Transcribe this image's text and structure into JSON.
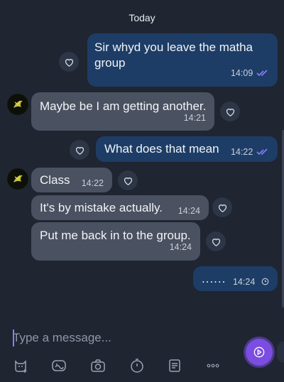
{
  "date_separator": "Today",
  "messages": [
    {
      "id": "m1",
      "direction": "out",
      "text_line1": "Sir whyd you leave the matha",
      "text_line2": "group",
      "time": "14:09",
      "status": "read"
    },
    {
      "id": "m2",
      "direction": "in",
      "text": "Maybe be I am getting another.",
      "time": "14:21"
    },
    {
      "id": "m3",
      "direction": "out",
      "text": "What does that mean",
      "time": "14:22",
      "status": "read"
    },
    {
      "id": "m4",
      "direction": "in",
      "text": "Class",
      "time": "14:22"
    },
    {
      "id": "m5",
      "direction": "in",
      "text": "It's by mistake actually.",
      "time": "14:24"
    },
    {
      "id": "m6",
      "direction": "in",
      "text": "Put me back in to the group.",
      "time": "14:24"
    },
    {
      "id": "m7",
      "direction": "out",
      "text": "......",
      "time": "14:24",
      "status": "pending"
    }
  ],
  "composer": {
    "placeholder": "Type a message..."
  },
  "icons": {
    "like": "heart-icon",
    "avatar": "contact-avatar",
    "toolbar": [
      "sticker-icon",
      "gif-sticker-icon",
      "camera-icon",
      "timer-icon",
      "notes-icon",
      "more-icon"
    ],
    "send": "voice-send-icon"
  },
  "colors": {
    "background": "#1f2531",
    "outgoing_bubble": "#1d3d66",
    "incoming_bubble": "#4a5160",
    "accent": "#7b4de0"
  }
}
